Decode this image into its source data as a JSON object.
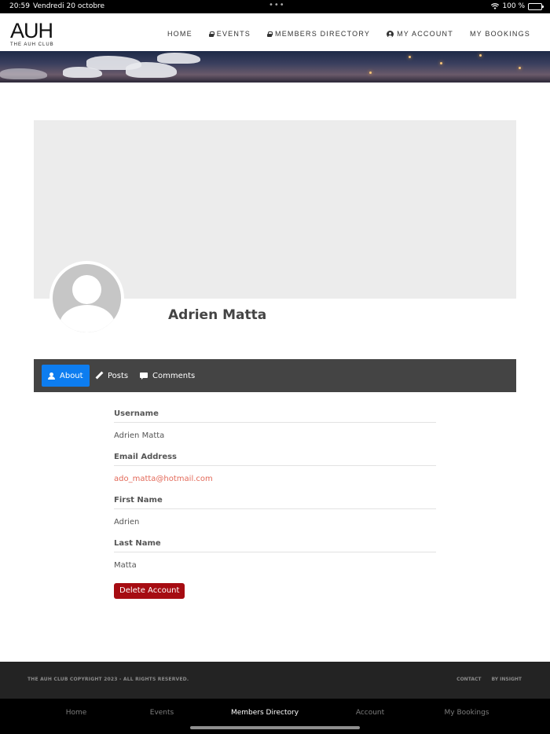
{
  "status_bar": {
    "time": "20:59",
    "date": "Vendredi 20 octobre",
    "battery": "100 %"
  },
  "header": {
    "logo_mark": "AUH",
    "logo_sub": "THE AUH CLUB",
    "nav": [
      {
        "label": "HOME",
        "icon": null
      },
      {
        "label": "EVENTS",
        "icon": "lock-icon"
      },
      {
        "label": "MEMBERS DIRECTORY",
        "icon": "lock-icon"
      },
      {
        "label": "MY ACCOUNT",
        "icon": "user-circle-icon"
      },
      {
        "label": "MY BOOKINGS",
        "icon": null
      }
    ]
  },
  "profile": {
    "name": "Adrien Matta"
  },
  "tabs": [
    {
      "label": "About",
      "icon": "person-icon",
      "active": true
    },
    {
      "label": "Posts",
      "icon": "pencil-icon",
      "active": false
    },
    {
      "label": "Comments",
      "icon": "comment-icon",
      "active": false
    }
  ],
  "fields": [
    {
      "label": "Username",
      "value": "Adrien Matta"
    },
    {
      "label": "Email Address",
      "value": "ado_matta@hotmail.com"
    },
    {
      "label": "First Name",
      "value": "Adrien"
    },
    {
      "label": "Last Name",
      "value": "Matta"
    }
  ],
  "delete_button": "Delete Account",
  "footer": {
    "copyright": "THE AUH CLUB COPYRIGHT 2023 - ALL RIGHTS RESERVED.",
    "links": [
      "CONTACT",
      "BY INSIGHT"
    ]
  },
  "app_tabs": [
    {
      "label": "Home",
      "active": false
    },
    {
      "label": "Events",
      "active": false
    },
    {
      "label": "Members Directory",
      "active": true
    },
    {
      "label": "Account",
      "active": false
    },
    {
      "label": "My Bookings",
      "active": false
    }
  ],
  "colors": {
    "accent": "#0d7df0",
    "danger": "#a60c12",
    "email": "#e36a5a",
    "tab_bar": "#444444"
  }
}
